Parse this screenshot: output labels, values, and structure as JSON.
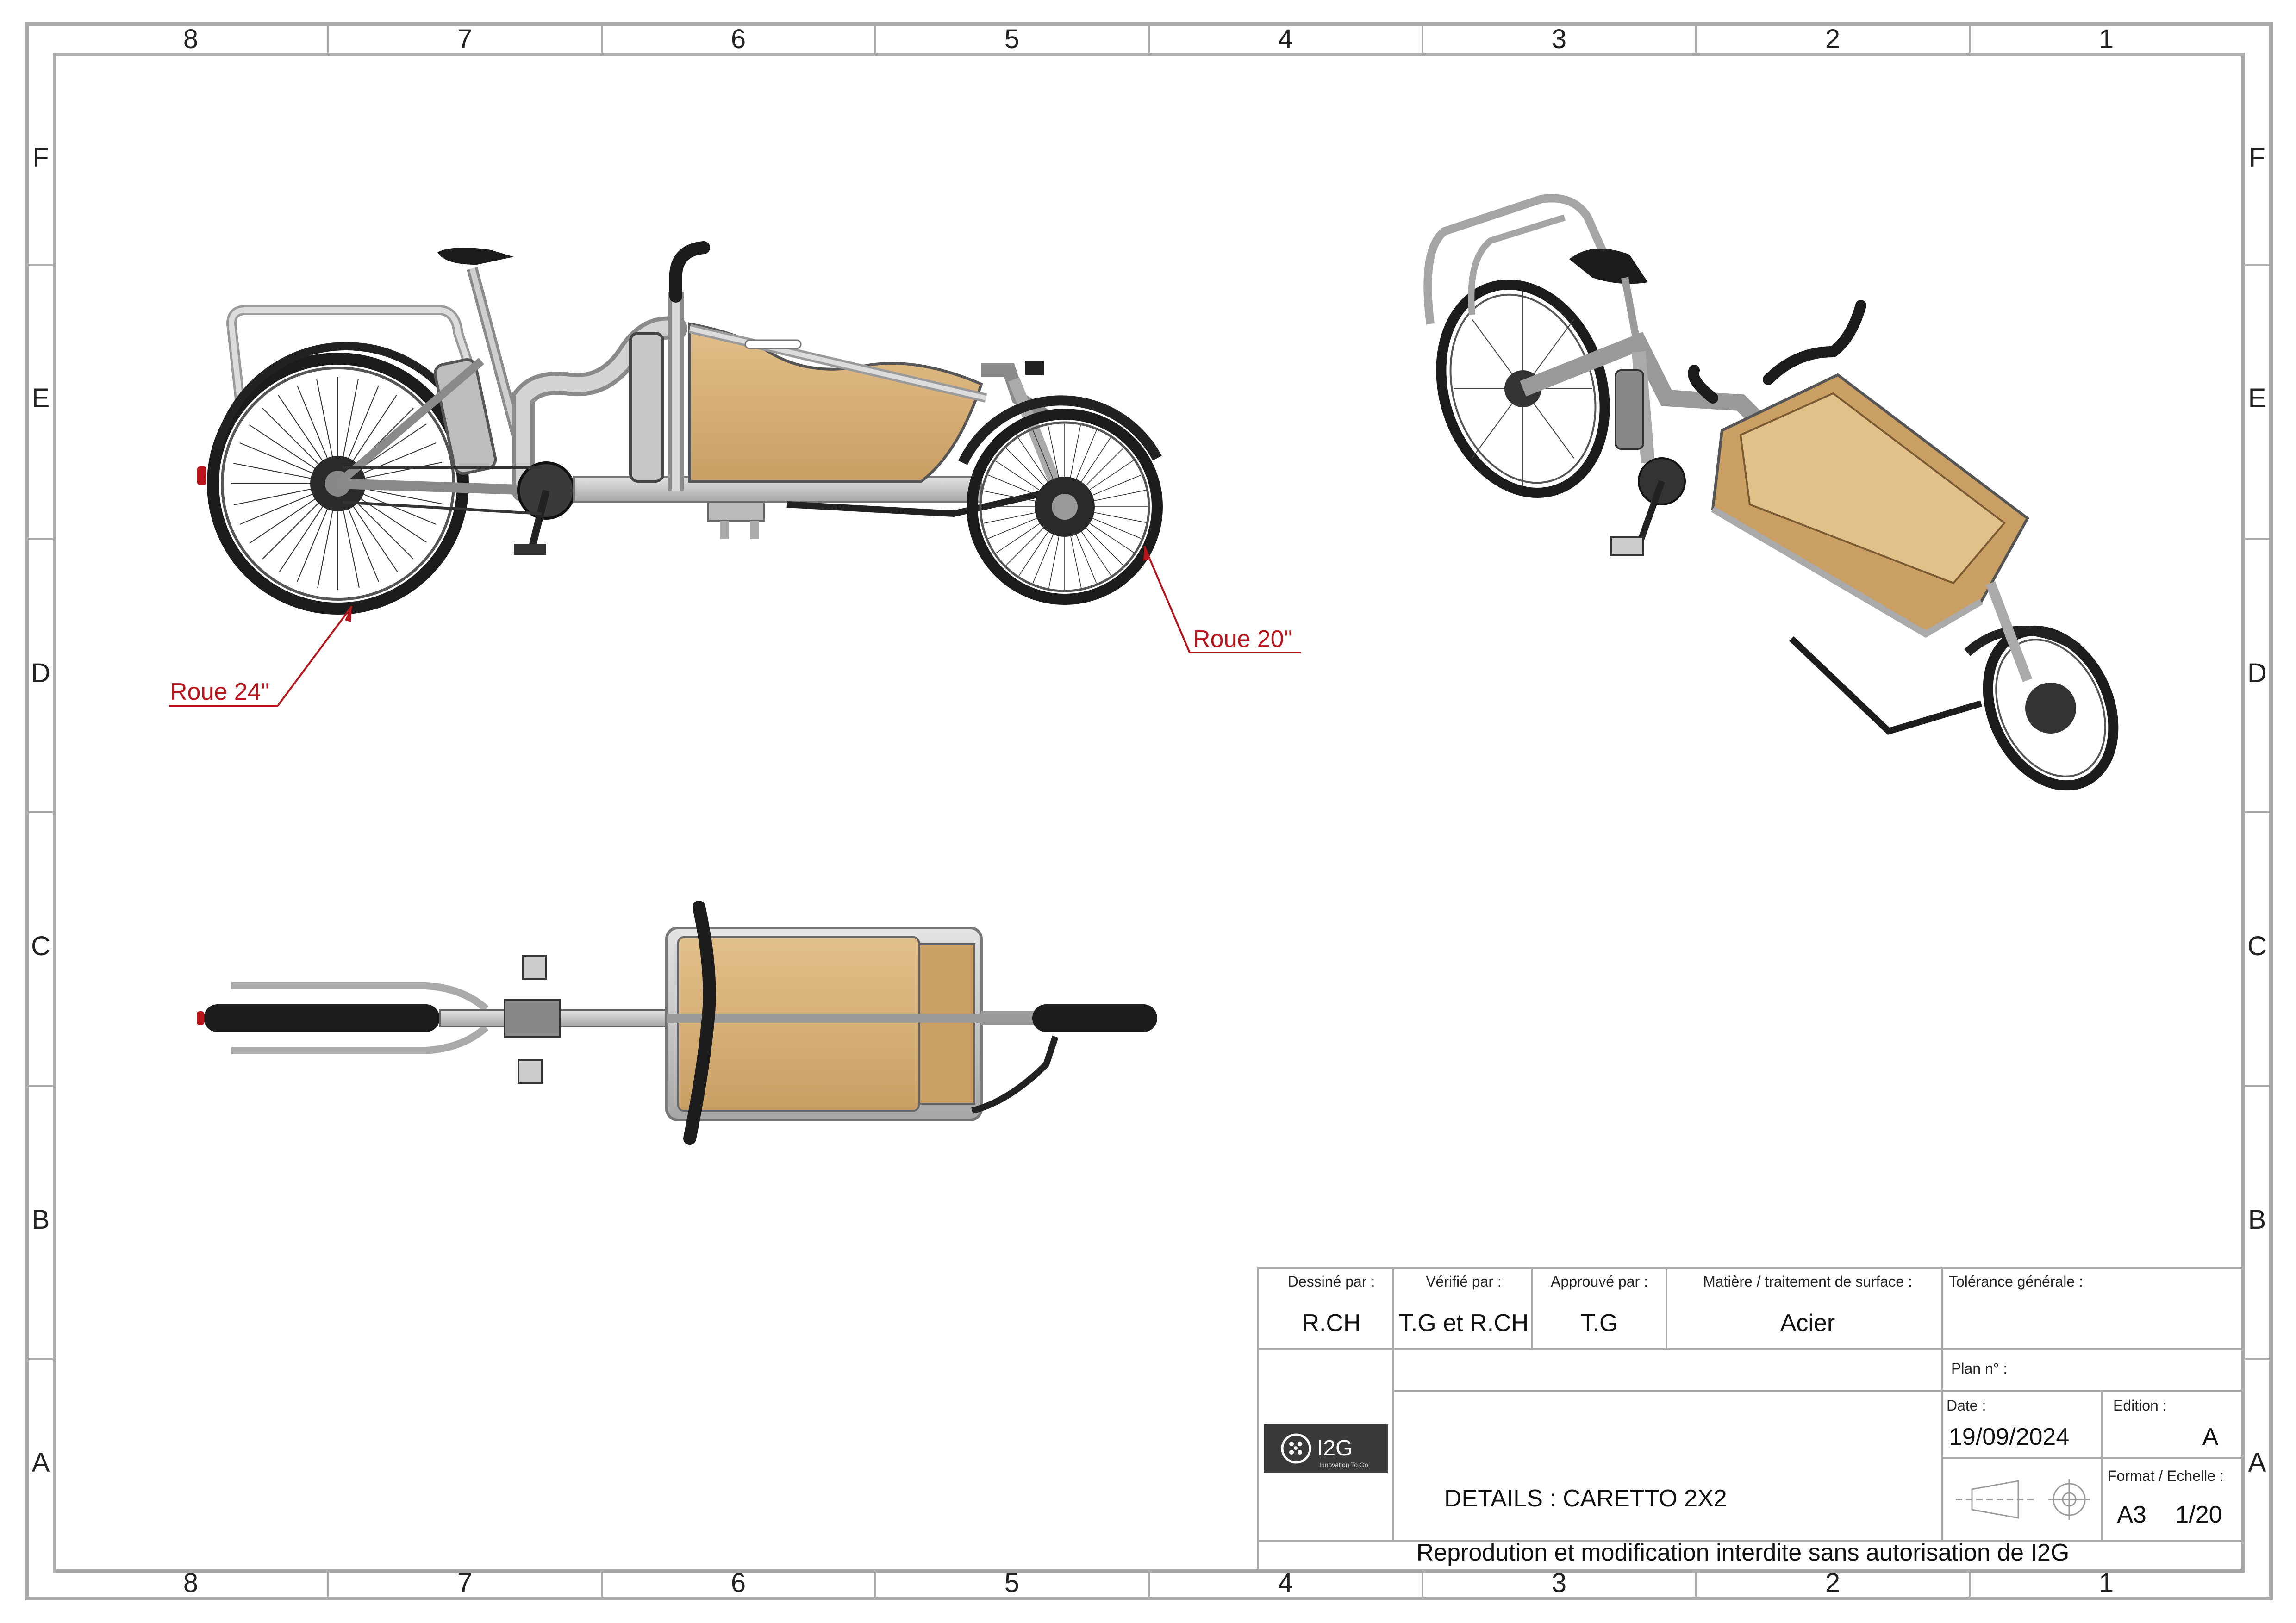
{
  "sheet": {
    "zones_columns": [
      "8",
      "7",
      "6",
      "5",
      "4",
      "3",
      "2",
      "1"
    ],
    "zones_rows": [
      "F",
      "E",
      "D",
      "C",
      "B",
      "A"
    ]
  },
  "callouts": {
    "rear_wheel": "Roue 24\"",
    "front_wheel": "Roue 20\""
  },
  "title_block": {
    "drawn_by_label": "Dessiné par :",
    "drawn_by": "R.CH",
    "checked_by_label": "Vérifié par :",
    "checked_by": "T.G et R.CH",
    "approved_by_label": "Approuvé par :",
    "approved_by": "T.G",
    "material_label": "Matière / traitement de surface :",
    "material": "Acier",
    "tolerance_label": "Tolérance générale :",
    "plan_label": "Plan n° :",
    "date_label": "Date :",
    "date": "19/09/2024",
    "edition_label": "Edition :",
    "edition": "A",
    "format_label": "Format / Echelle :",
    "format": "A3",
    "scale": "1/20",
    "title": "DETAILS : CARETTO 2X2",
    "logo_text": "I2G",
    "logo_tagline": "Innovation To Go",
    "notice": "Reprodution et modification interdite sans autorisation de I2G"
  },
  "colors": {
    "frame": "#a9a9a9",
    "metal": "#c8c8c8",
    "wood": "#d8b27c",
    "tire": "#1c1c1c",
    "callout": "#b8141c"
  }
}
